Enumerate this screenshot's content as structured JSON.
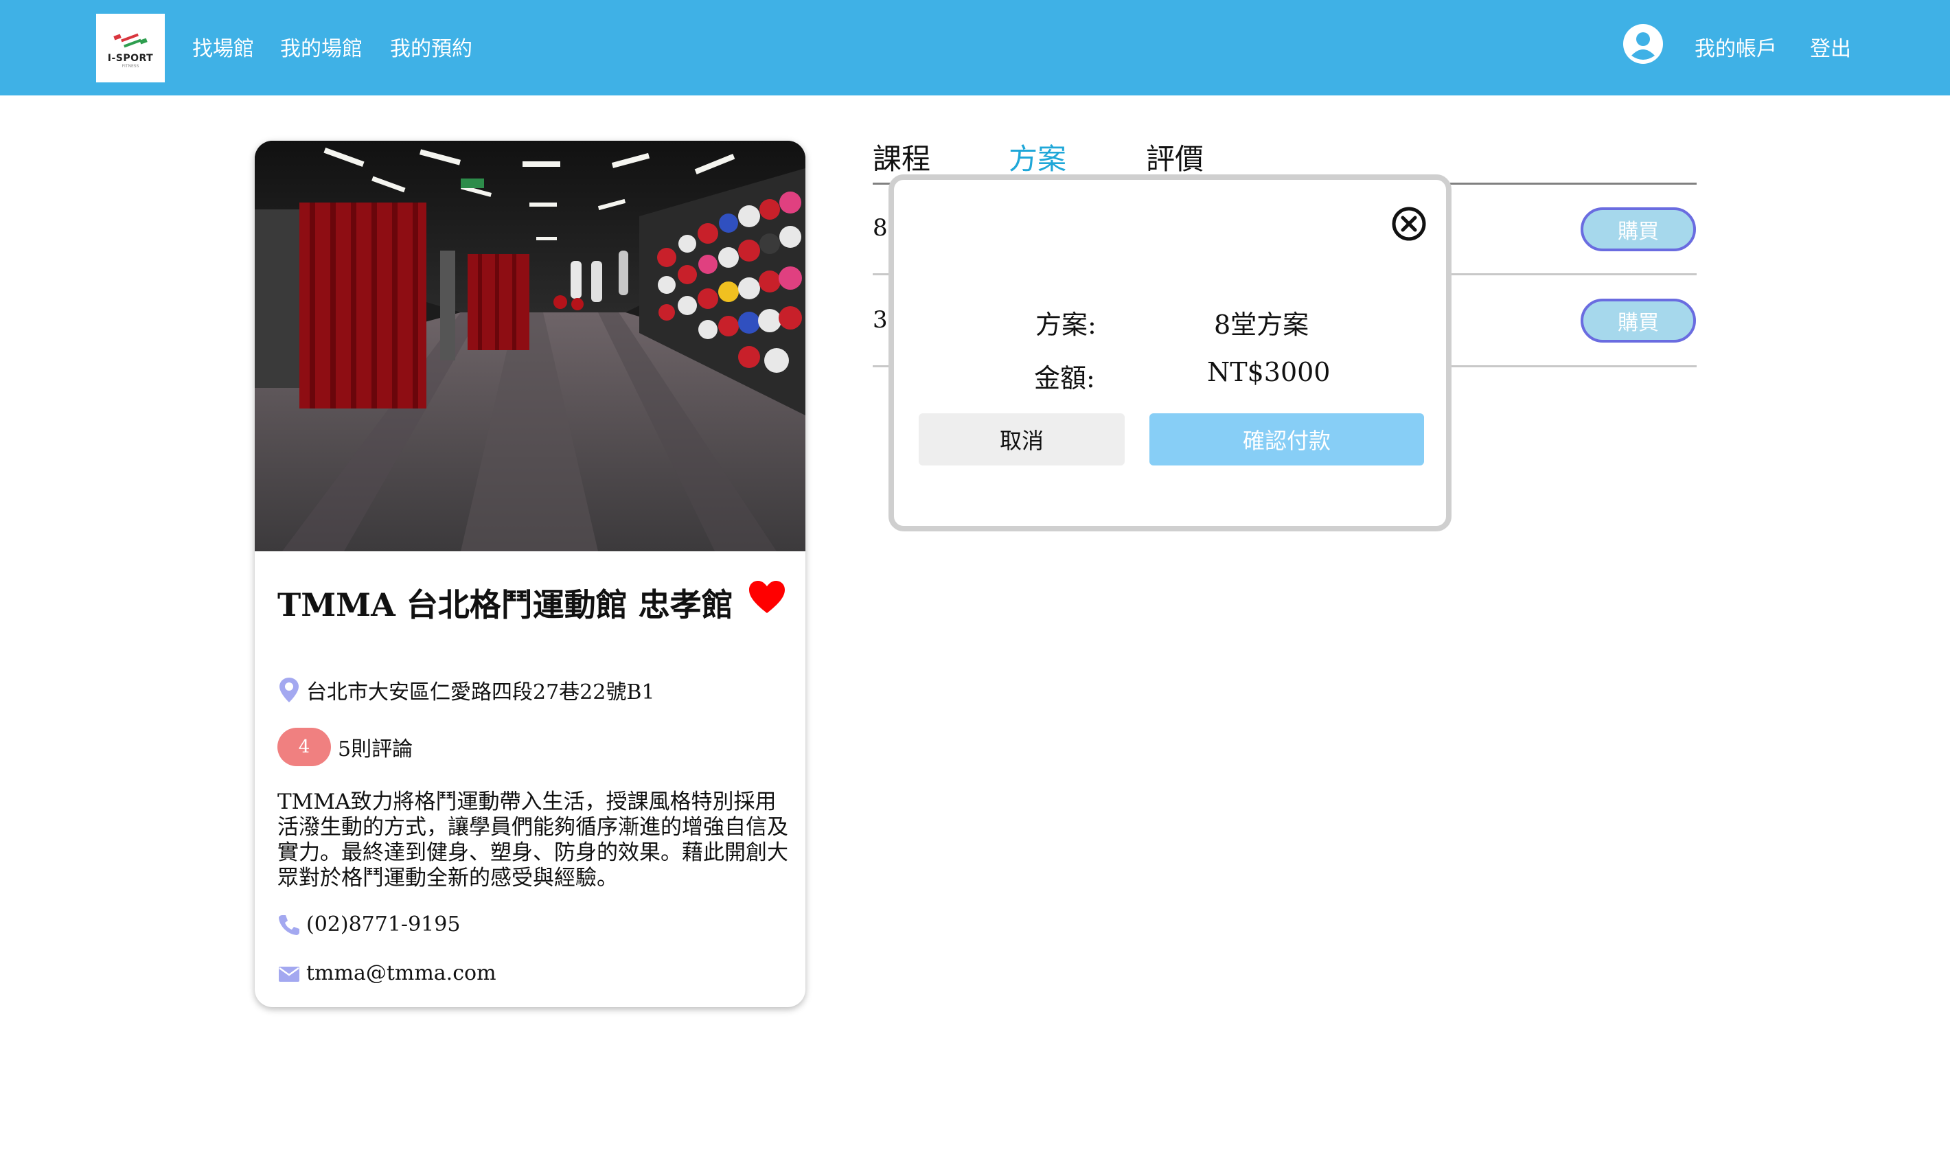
{
  "brand": {
    "logo_text": "I-SPORT",
    "logo_sub": "FITNESS"
  },
  "nav": {
    "links": [
      "找場館",
      "我的場館",
      "我的預約"
    ],
    "account_label": "我的帳戶",
    "logout_label": "登出"
  },
  "gym": {
    "name": "TMMA 台北格鬥運動館 忠孝館",
    "address": "台北市大安區仁愛路四段27巷22號B1",
    "rating": "4",
    "reviews": "5則評論",
    "description": "TMMA致力將格鬥運動帶入生活，授課風格特別採用活潑生動的方式，讓學員們能夠循序漸進的增強自信及實力。最終達到健身、塑身、防身的效果。藉此開創大眾對於格鬥運動全新的感受與經驗。",
    "phone": "(02)8771-9195",
    "email": "tmma@tmma.com"
  },
  "tabs": [
    "課程",
    "方案",
    "評價"
  ],
  "active_tab": "方案",
  "plans": [
    {
      "label_fragment": "8",
      "buy_label": "購買"
    },
    {
      "label_fragment": "3(",
      "buy_label": "購買"
    }
  ],
  "modal": {
    "plan_label": "方案:",
    "plan_value": "8堂方案",
    "amount_label": "金額:",
    "amount_value": "NT$3000",
    "cancel_label": "取消",
    "confirm_label": "確認付款"
  },
  "colors": {
    "navbar": "#3fb1e6",
    "active_tab": "#1fa7d8",
    "buy_button": "#a6d8ec",
    "buy_border": "#6a6ce0",
    "confirm_button": "#87cef6",
    "rating_badge": "#f08080",
    "heart": "#ff0000",
    "icon_accent": "#a3a8f0"
  },
  "icons": {
    "logo": "dumbbell-logo-icon",
    "avatar": "user-avatar-icon",
    "favorite": "heart-icon",
    "address": "location-pin-icon",
    "phone": "phone-icon",
    "email": "mail-icon",
    "close": "close-circle-icon"
  }
}
